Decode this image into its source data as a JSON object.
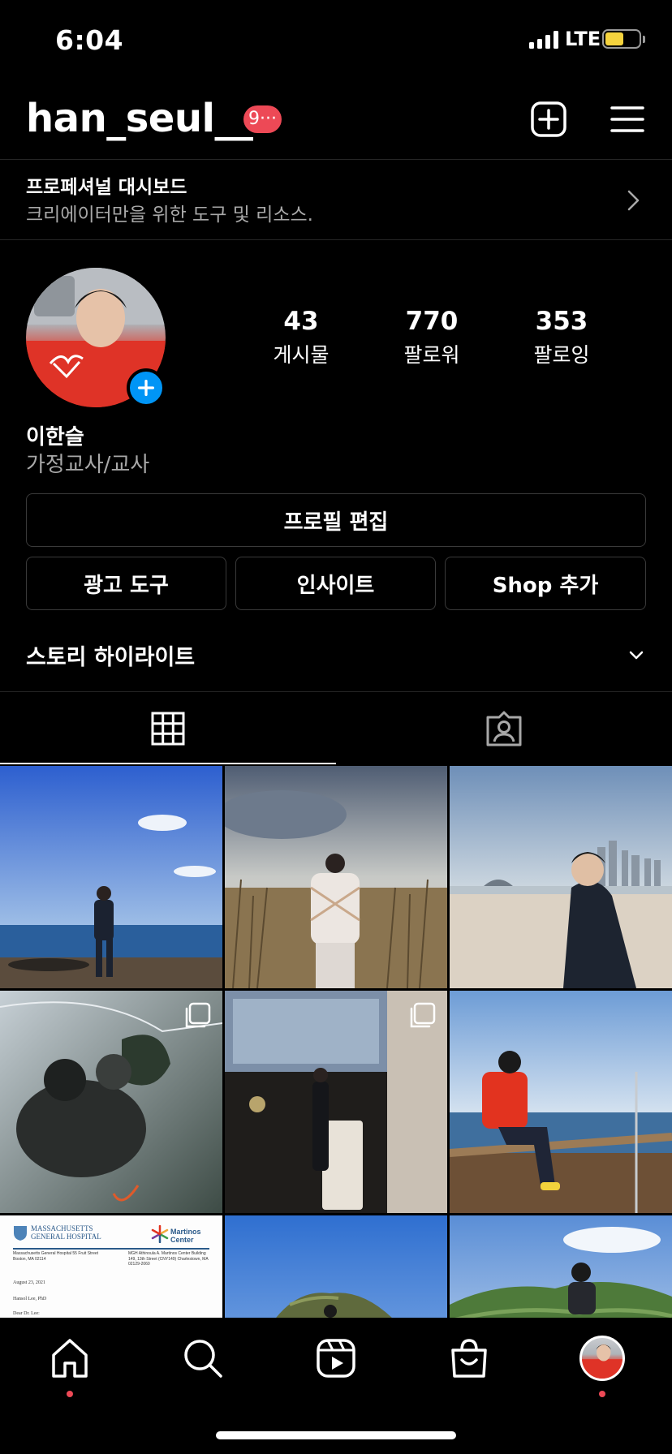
{
  "status_bar": {
    "time": "6:04",
    "network": "LTE",
    "battery_level": 0.55
  },
  "header": {
    "username": "han_seul__",
    "notification_badge": "9···",
    "icons": [
      "add-post-icon",
      "menu-icon"
    ]
  },
  "pro_dashboard": {
    "title": "프로페셔널 대시보드",
    "subtitle": "크리에이터만을 위한 도구 및 리소스."
  },
  "profile": {
    "stats": [
      {
        "value": "43",
        "label": "게시물"
      },
      {
        "value": "770",
        "label": "팔로워"
      },
      {
        "value": "353",
        "label": "팔로잉"
      }
    ],
    "display_name": "이한슬",
    "category": "가정교사/교사"
  },
  "buttons": {
    "edit_profile": "프로필 편집",
    "ad_tools": "광고 도구",
    "insights": "인사이트",
    "add_shop": "Shop 추가"
  },
  "highlights": {
    "label": "스토리 하이라이트"
  },
  "tabs": [
    {
      "name": "grid",
      "icon": "grid-icon"
    },
    {
      "name": "tagged",
      "icon": "tagged-icon"
    }
  ],
  "posts": [
    {
      "theme": "beach-sea",
      "multi": false
    },
    {
      "theme": "reed-field",
      "multi": false
    },
    {
      "theme": "beach-city",
      "multi": false
    },
    {
      "theme": "paragliding",
      "multi": true
    },
    {
      "theme": "speech-hall",
      "multi": true
    },
    {
      "theme": "sea-deck",
      "multi": false
    },
    {
      "theme": "document",
      "multi": false,
      "doc": {
        "org_left": "MASSACHUSETTS GENERAL HOSPITAL",
        "org_right": "Martinos Center",
        "address_left": "Massachusetts General Hospital 55 Fruit Street Boston, MA 02114",
        "address_right": "MGH Athinoula A. Martinos Center Building 149, 13th Street (CNY149) Charlestown, MA 02129-2060",
        "date": "August 23, 2021",
        "recipient": "Hansol Lee, PhD",
        "salutation": "Dear Dr. Lee:"
      }
    },
    {
      "theme": "green-hill",
      "multi": false
    },
    {
      "theme": "green-hill-2",
      "multi": false
    }
  ],
  "bottom_nav": [
    "home-icon",
    "search-icon",
    "reels-icon",
    "shop-icon",
    "profile-avatar"
  ],
  "colors": {
    "accent": "#0095f6",
    "badge": "#ed4956",
    "battery": "#f5d33e"
  }
}
